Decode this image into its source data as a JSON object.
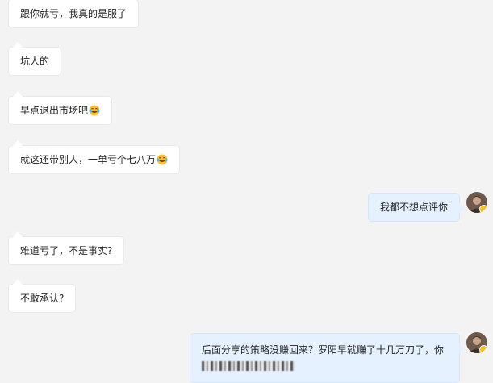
{
  "messages": [
    {
      "side": "in",
      "text": "跟你就亏，我真的是服了"
    },
    {
      "side": "in",
      "text": "坑人的"
    },
    {
      "side": "in",
      "text": "早点退出市场吧",
      "emoji": "laugh-cry-emoji"
    },
    {
      "side": "in",
      "text": "就这还带别人，一单亏个七八万",
      "emoji": "laugh-cry-emoji"
    },
    {
      "side": "out",
      "text": "我都不想点评你"
    },
    {
      "side": "in",
      "text": "难道亏了，不是事实?"
    },
    {
      "side": "in",
      "text": "不敢承认?"
    },
    {
      "side": "out",
      "text": "后面分享的策略没赚回来？罗阳早就赚了十几万刀了，你",
      "redacted_second_line": true
    }
  ],
  "colors": {
    "background": "#f3f3f3",
    "incoming_bubble": "#ffffff",
    "outgoing_bubble": "#e6f1ff",
    "avatar_badge": "#f5c21b"
  }
}
